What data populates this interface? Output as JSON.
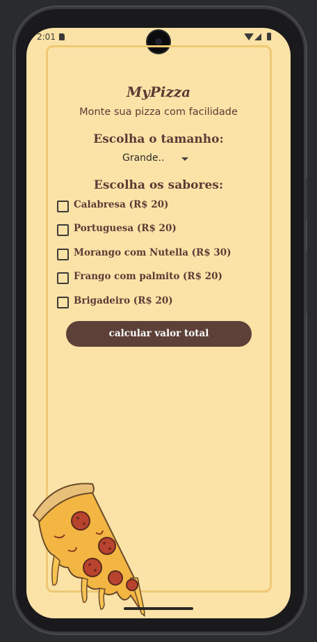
{
  "status_bar": {
    "time": "2:01",
    "icons": [
      "sd-card-icon",
      "wifi-icon",
      "signal-icon",
      "battery-icon"
    ]
  },
  "app": {
    "title": "MyPizza",
    "subtitle": "Monte sua pizza com facilidade"
  },
  "size_section": {
    "title": "Escolha o tamanho:",
    "selected": "Grande.."
  },
  "flavors_section": {
    "title": "Escolha os sabores:",
    "items": [
      {
        "label": "Calabresa (R$ 20)",
        "checked": false
      },
      {
        "label": "Portuguesa (R$ 20)",
        "checked": false
      },
      {
        "label": "Morango com Nutella (R$ 30)",
        "checked": false
      },
      {
        "label": "Frango com palmito (R$ 20)",
        "checked": false
      },
      {
        "label": "Brigadeiro (R$ 20)",
        "checked": false
      }
    ]
  },
  "actions": {
    "calculate_label": "calcular valor total"
  },
  "colors": {
    "background": "#fbe3a8",
    "border": "#efc874",
    "text": "#5a3c34",
    "button": "#5d4038"
  }
}
